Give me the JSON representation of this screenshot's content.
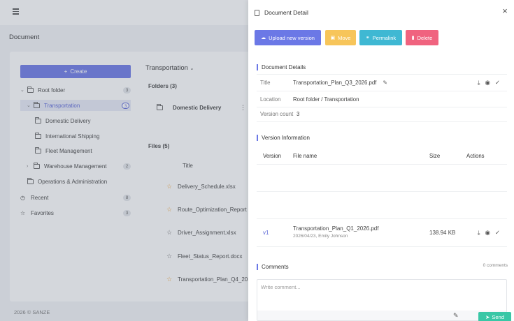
{
  "app": {
    "page_title": "Document",
    "footer": "2026 © SANZE",
    "create_label": "Create",
    "breadcrumb": "Transportation",
    "folders_header": "Folders (3)",
    "files_header": "Files (5)",
    "files_col_title": "Title",
    "folder_card": "Domestic Delivery"
  },
  "tree": [
    {
      "label": "Root folder",
      "count": "3"
    },
    {
      "label": "Transportation",
      "count": "3"
    },
    {
      "label": "Domestic Delivery",
      "count": ""
    },
    {
      "label": "International Shipping",
      "count": ""
    },
    {
      "label": "Fleet Management",
      "count": ""
    },
    {
      "label": "Warehouse Management",
      "count": "2"
    },
    {
      "label": "Operations & Administration",
      "count": ""
    },
    {
      "label": "Recent",
      "count": "8"
    },
    {
      "label": "Favorites",
      "count": "3"
    }
  ],
  "files": [
    "Delivery_Schedule.xlsx",
    "Route_Optimization_Report",
    "Driver_Assignment.xlsx",
    "Fleet_Status_Report.docx",
    "Transportation_Plan_Q4_20"
  ],
  "drawer": {
    "title": "Document Detail",
    "buttons": {
      "upload": "Upload new version",
      "move": "Move",
      "permalink": "Permalink",
      "delete": "Delete"
    },
    "details_title": "Document Details",
    "details": [
      {
        "key": "Title",
        "value": "Transportation_Plan_Q3_2026.pdf"
      },
      {
        "key": "Location",
        "value": "Root folder / Transportation"
      },
      {
        "key": "Version count",
        "value": "3"
      }
    ],
    "version_title": "Version Information",
    "version_columns": [
      "Version",
      "File name",
      "Size",
      "Actions"
    ],
    "versions": [
      {
        "version": "v1",
        "file": "Transportation_Plan_Q1_2026.pdf",
        "meta": "2026/04/23, Emily Johnson",
        "size": "138.94 KB"
      }
    ],
    "comments_title": "Comments",
    "comments_count": "0 comments",
    "comment_placeholder": "Write comment...",
    "send_label": "Send"
  },
  "colors": {
    "primary": "#6b78e6",
    "move": "#f7c55a",
    "permalink": "#3fb8d3",
    "delete": "#f0637f",
    "send": "#39c7a6"
  }
}
